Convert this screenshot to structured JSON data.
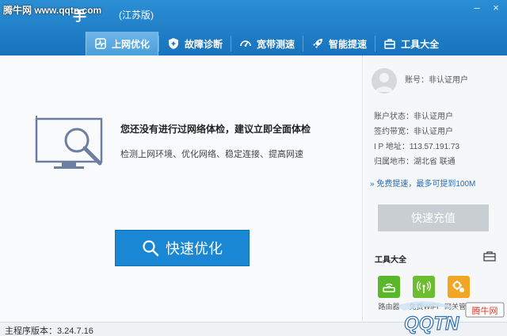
{
  "watermark_top_left": "腾牛网 www.qqtn.com",
  "app": {
    "title": "手",
    "edition": "(江苏版)"
  },
  "window_controls": {
    "minimize": "–",
    "close": "×"
  },
  "tabs": [
    {
      "label": "上网优化",
      "icon": "wifi-pulse-icon",
      "active": true
    },
    {
      "label": "故障诊断",
      "icon": "shield-plus-icon",
      "active": false
    },
    {
      "label": "宽带测速",
      "icon": "speedometer-icon",
      "active": false
    },
    {
      "label": "智能提速",
      "icon": "rocket-icon",
      "active": false
    },
    {
      "label": "工具大全",
      "icon": "toolbox-icon",
      "active": false
    }
  ],
  "main": {
    "headline": "您还没有进行过网络体检，建议立即全面体检",
    "subline": "检测上网环境、优化网络、稳定连接、提高网速",
    "primary_button": "快速优化"
  },
  "sidebar": {
    "account": "账号：非认证用户",
    "info": [
      {
        "label": "账户状态：",
        "value": "非认证用户"
      },
      {
        "label": "签约带宽：",
        "value": "非认证用户"
      },
      {
        "label": "I P 地址：",
        "value": "113.57.191.73"
      },
      {
        "label": "归属地市：",
        "value": "湖北省 联通"
      }
    ],
    "promo": "» 免费提速，最多可提到100M",
    "recharge_button": "快速充值",
    "tools_title": "工具大全",
    "tools": [
      {
        "label": "路由器",
        "icon": "router-icon",
        "color": "#59b82a"
      },
      {
        "label": "免费WIFI",
        "icon": "wifi-signal-icon",
        "color": "#6cbd2f"
      },
      {
        "label": "网关管家",
        "icon": "gateway-gear-icon",
        "color": "#f2a623"
      }
    ]
  },
  "statusbar": {
    "version": "主程序版本：3.24.7.16"
  },
  "watermark_bottom_right": {
    "brand": "QQTN",
    "tag": "腾牛网"
  },
  "colors": {
    "header": "#1a7fc9",
    "primary": "#1a87d4",
    "accent_link": "#1f6fc2"
  }
}
